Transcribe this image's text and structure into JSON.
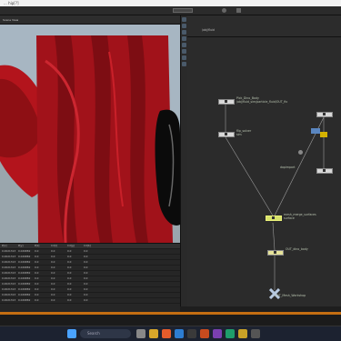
{
  "window": {
    "title": "... hip[?]"
  },
  "viewport_tab": {
    "label": "Scene View"
  },
  "network": {
    "path": "/obj/fluid",
    "nodes": [
      {
        "name": "Pick_Dino_Body",
        "sub": "/obj/fluid_sim/particle_fluid/OUT_fix"
      },
      {
        "name": "flip_solver",
        "sub": "sim"
      },
      {
        "name": "dopimport",
        "sub": ""
      },
      {
        "name": "mesh_merge_surfaces",
        "sub": "surface"
      },
      {
        "name": "OUT_dino_body",
        "sub": ""
      },
      {
        "name": "OUT_Mesh_Workshop",
        "sub": ""
      }
    ]
  },
  "spreadsheet": {
    "columns": [
      "P[x]",
      "P[y]",
      "P[z]",
      "Cd[r]",
      "Cd[g]",
      "Cd[b]"
    ],
    "rows": [
      [
        "0.0021313",
        "0.049882",
        "0.0",
        "0.0",
        "0.0",
        "0.0"
      ],
      [
        "0.0021313",
        "0.049882",
        "0.0",
        "0.0",
        "0.0",
        "0.0"
      ],
      [
        "0.0021313",
        "0.049882",
        "0.0",
        "0.0",
        "0.0",
        "0.0"
      ],
      [
        "0.0021313",
        "0.049882",
        "0.0",
        "0.0",
        "0.0",
        "0.0"
      ],
      [
        "0.0021313",
        "0.049882",
        "0.0",
        "0.0",
        "0.0",
        "0.0"
      ],
      [
        "0.0021313",
        "0.049882",
        "0.0",
        "0.0",
        "0.0",
        "0.0"
      ],
      [
        "0.0021313",
        "0.049882",
        "0.0",
        "0.0",
        "0.0",
        "0.0"
      ],
      [
        "0.0021313",
        "0.049882",
        "0.0",
        "0.0",
        "0.0",
        "0.0"
      ],
      [
        "0.0021313",
        "0.049882",
        "0.0",
        "0.0",
        "0.0",
        "0.0"
      ],
      [
        "0.0021313",
        "0.049882",
        "0.0",
        "0.0",
        "0.0",
        "0.0"
      ]
    ]
  },
  "taskbar": {
    "search_placeholder": "Search"
  },
  "colors": {
    "accent": "#c46e12",
    "node_highlight": "#d7e36a",
    "blood": "#b3141c"
  }
}
